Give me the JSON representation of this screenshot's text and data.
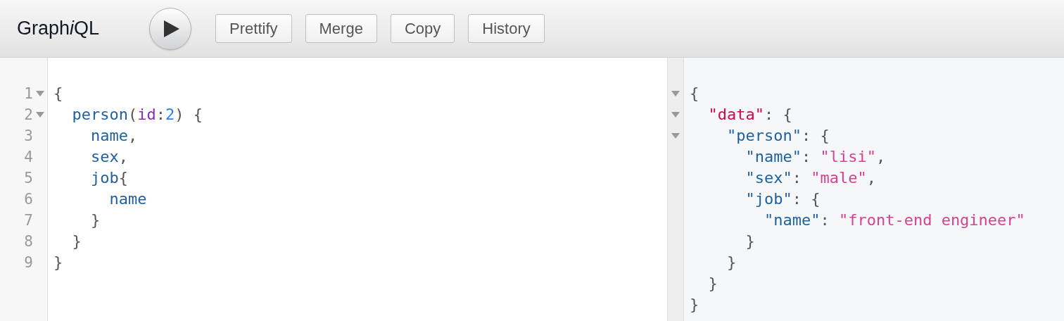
{
  "toolbar": {
    "title": [
      {
        "text": "Graph",
        "italic": false
      },
      {
        "text": "i",
        "italic": true
      },
      {
        "text": "QL",
        "italic": false
      }
    ],
    "buttons": [
      "Prettify",
      "Merge",
      "Copy",
      "History"
    ]
  },
  "editor": {
    "lines": [
      {
        "number": "1",
        "foldable": true,
        "tokens": [
          {
            "text": "{",
            "kind": "punct"
          }
        ]
      },
      {
        "number": "2",
        "foldable": true,
        "tokens": [
          {
            "text": "  person",
            "kind": "field"
          },
          {
            "text": "(",
            "kind": "punct"
          },
          {
            "text": "id",
            "kind": "attr"
          },
          {
            "text": ":",
            "kind": "punct"
          },
          {
            "text": "2",
            "kind": "number"
          },
          {
            "text": ") {",
            "kind": "punct"
          }
        ]
      },
      {
        "number": "3",
        "foldable": false,
        "tokens": [
          {
            "text": "    name",
            "kind": "field"
          },
          {
            "text": ",",
            "kind": "punct"
          }
        ]
      },
      {
        "number": "4",
        "foldable": false,
        "tokens": [
          {
            "text": "    sex",
            "kind": "field"
          },
          {
            "text": ",",
            "kind": "punct"
          }
        ]
      },
      {
        "number": "5",
        "foldable": false,
        "tokens": [
          {
            "text": "    job",
            "kind": "field"
          },
          {
            "text": "{",
            "kind": "punct"
          }
        ]
      },
      {
        "number": "6",
        "foldable": false,
        "tokens": [
          {
            "text": "      name",
            "kind": "field"
          }
        ]
      },
      {
        "number": "7",
        "foldable": false,
        "tokens": [
          {
            "text": "    }",
            "kind": "punct"
          }
        ]
      },
      {
        "number": "8",
        "foldable": false,
        "tokens": [
          {
            "text": "  }",
            "kind": "punct"
          }
        ]
      },
      {
        "number": "9",
        "foldable": false,
        "tokens": [
          {
            "text": "}",
            "kind": "punct"
          }
        ]
      }
    ]
  },
  "result": {
    "lines": [
      {
        "foldable": true,
        "tokens": [
          {
            "text": "{",
            "kind": "punct"
          }
        ]
      },
      {
        "foldable": true,
        "tokens": [
          {
            "text": "  \"data\"",
            "kind": "rootkey"
          },
          {
            "text": ": {",
            "kind": "punct"
          }
        ]
      },
      {
        "foldable": true,
        "tokens": [
          {
            "text": "    \"person\"",
            "kind": "key"
          },
          {
            "text": ": {",
            "kind": "punct"
          }
        ]
      },
      {
        "foldable": false,
        "tokens": [
          {
            "text": "      \"name\"",
            "kind": "key"
          },
          {
            "text": ": ",
            "kind": "punct"
          },
          {
            "text": "\"lisi\"",
            "kind": "string"
          },
          {
            "text": ",",
            "kind": "punct"
          }
        ]
      },
      {
        "foldable": false,
        "tokens": [
          {
            "text": "      \"sex\"",
            "kind": "key"
          },
          {
            "text": ": ",
            "kind": "punct"
          },
          {
            "text": "\"male\"",
            "kind": "string"
          },
          {
            "text": ",",
            "kind": "punct"
          }
        ]
      },
      {
        "foldable": false,
        "tokens": [
          {
            "text": "      \"job\"",
            "kind": "key"
          },
          {
            "text": ": {",
            "kind": "punct"
          }
        ]
      },
      {
        "foldable": false,
        "tokens": [
          {
            "text": "        \"name\"",
            "kind": "key"
          },
          {
            "text": ": ",
            "kind": "punct"
          },
          {
            "text": "\"front-end engineer\"",
            "kind": "string"
          }
        ]
      },
      {
        "foldable": false,
        "tokens": [
          {
            "text": "      }",
            "kind": "punct"
          }
        ]
      },
      {
        "foldable": false,
        "tokens": [
          {
            "text": "    }",
            "kind": "punct"
          }
        ]
      },
      {
        "foldable": false,
        "tokens": [
          {
            "text": "  }",
            "kind": "punct"
          }
        ]
      },
      {
        "foldable": false,
        "tokens": [
          {
            "text": "}",
            "kind": "punct"
          }
        ]
      }
    ]
  }
}
